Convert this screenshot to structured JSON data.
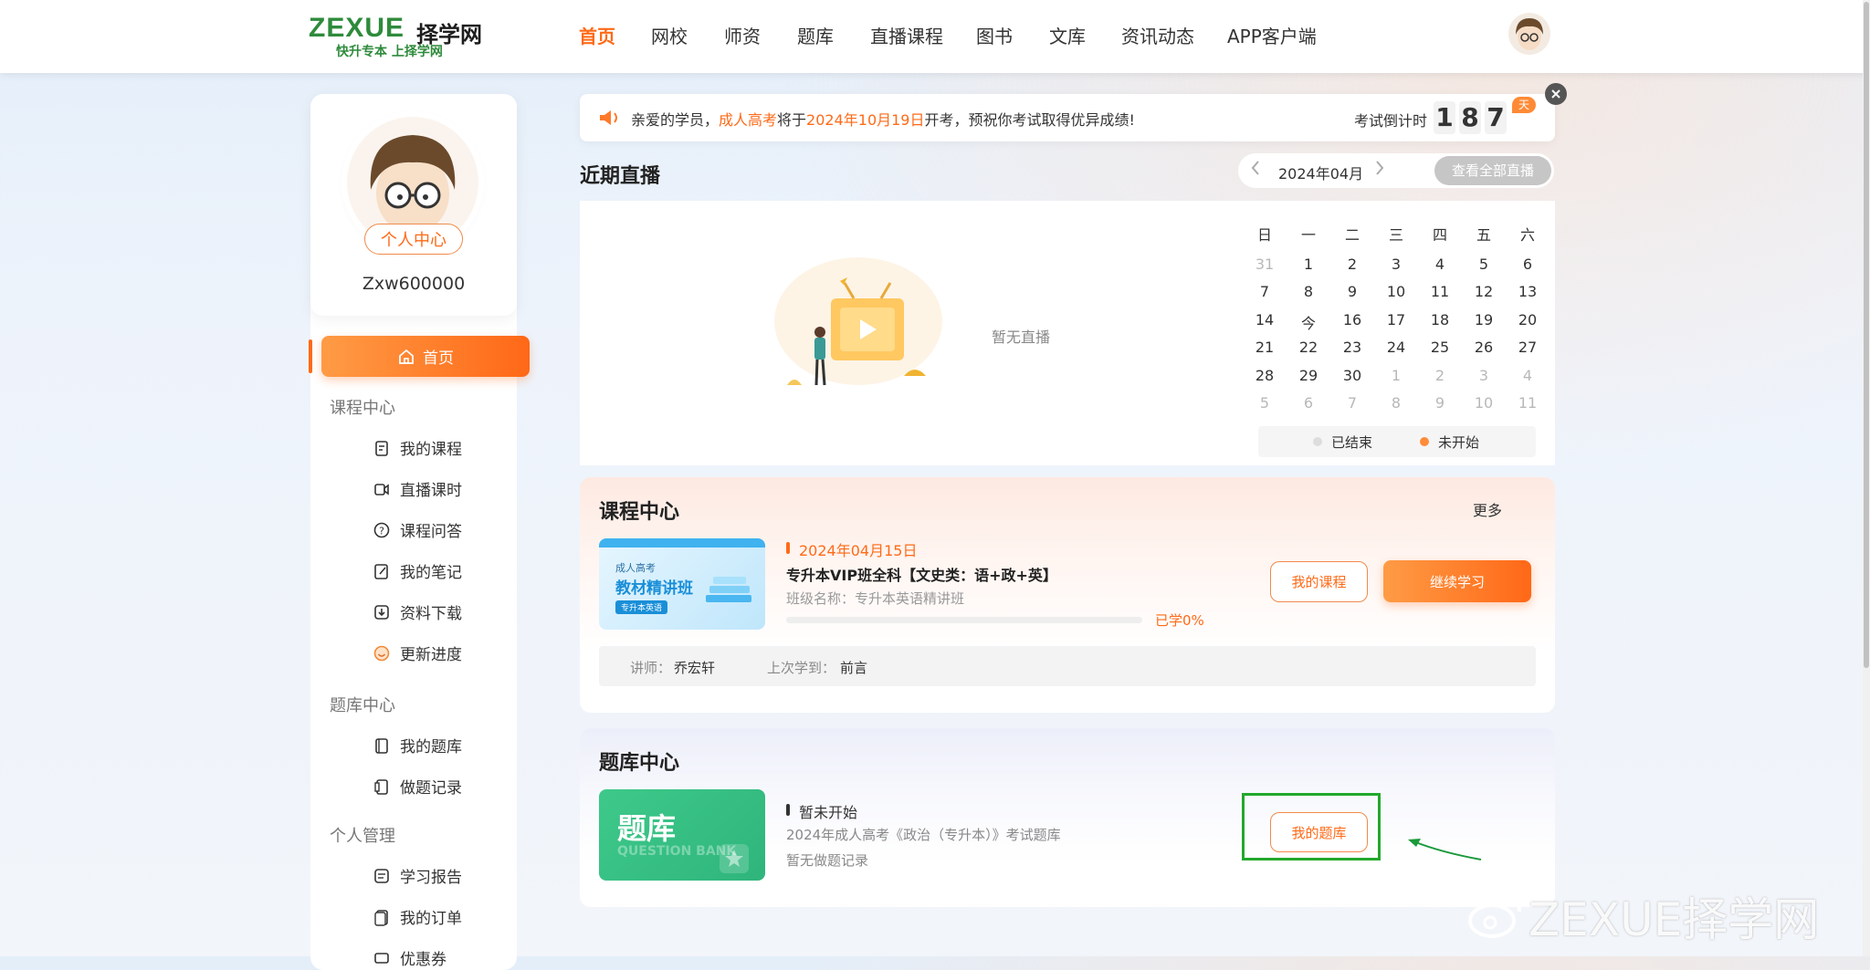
{
  "header": {
    "logo_text": "ZEXUE",
    "logo_cn": "择学网",
    "logo_slogan": "快升专本 上择学网",
    "nav": [
      "首页",
      "网校",
      "师资",
      "题库",
      "直播课程",
      "图书",
      "文库",
      "资讯动态",
      "APP客户端"
    ]
  },
  "sidebar": {
    "profile_button": "个人中心",
    "username": "Zxw600000",
    "home_label": "首页",
    "sections": [
      {
        "title": "课程中心",
        "items": [
          "我的课程",
          "直播课时",
          "课程问答",
          "我的笔记",
          "资料下载",
          "更新进度"
        ]
      },
      {
        "title": "题库中心",
        "items": [
          "我的题库",
          "做题记录"
        ]
      },
      {
        "title": "个人管理",
        "items": [
          "学习报告",
          "我的订单",
          "优惠券"
        ]
      }
    ]
  },
  "notice": {
    "t1": "亲爱的学员，",
    "t2": "成人高考",
    "t3": "将于",
    "t4": "2024年10月19日",
    "t5": "开考，预祝你考试取得优异成绩!",
    "countdown_label": "考试倒计时",
    "digits": [
      "1",
      "8",
      "7"
    ],
    "unit": "天"
  },
  "live": {
    "title": "近期直播",
    "month": "2024年04月",
    "view_all": "查看全部直播",
    "empty": "暂无直播"
  },
  "calendar": {
    "weekdays": [
      "日",
      "一",
      "二",
      "三",
      "四",
      "五",
      "六"
    ],
    "days": [
      "31",
      "1",
      "2",
      "3",
      "4",
      "5",
      "6",
      "7",
      "8",
      "9",
      "10",
      "11",
      "12",
      "13",
      "14",
      "今",
      "16",
      "17",
      "18",
      "19",
      "20",
      "21",
      "22",
      "23",
      "24",
      "25",
      "26",
      "27",
      "28",
      "29",
      "30",
      "1",
      "2",
      "3",
      "4",
      "5",
      "6",
      "7",
      "8",
      "9",
      "10",
      "11"
    ],
    "legend_ended": "已结束",
    "legend_not_started": "未开始",
    "colors": {
      "ended": "#dddddd",
      "not_started": "#ff8c3a"
    }
  },
  "course_center": {
    "title": "课程中心",
    "more": "更多",
    "thumb": {
      "small": "成人高考",
      "main": "教材精讲班",
      "tag": "专升本英语"
    },
    "date": "2024年04月15日",
    "course_name": "专升本VIP班全科【文史类：语+政+英】",
    "class_label": "班级名称：",
    "class_name": "专升本英语精讲班",
    "progress_text": "已学0%",
    "progress_value": 0,
    "my_course_button": "我的课程",
    "continue_button": "继续学习",
    "teacher_label": "讲师：",
    "teacher": "乔宏轩",
    "last_label": "上次学到：",
    "last": "前言"
  },
  "bank_center": {
    "title": "题库中心",
    "thumb_cn": "题库",
    "thumb_en": "QUESTION BANK",
    "status": "暂未开始",
    "name": "2024年成人高考《政治（专升本）》考试题库",
    "record": "暂无做题记录",
    "my_bank_button": "我的题库"
  },
  "watermark": "ZEXUE择学网",
  "colors": {
    "accent": "#ff6a17",
    "highlight_box": "#22a82d",
    "arrow": "#1a9a3a"
  }
}
